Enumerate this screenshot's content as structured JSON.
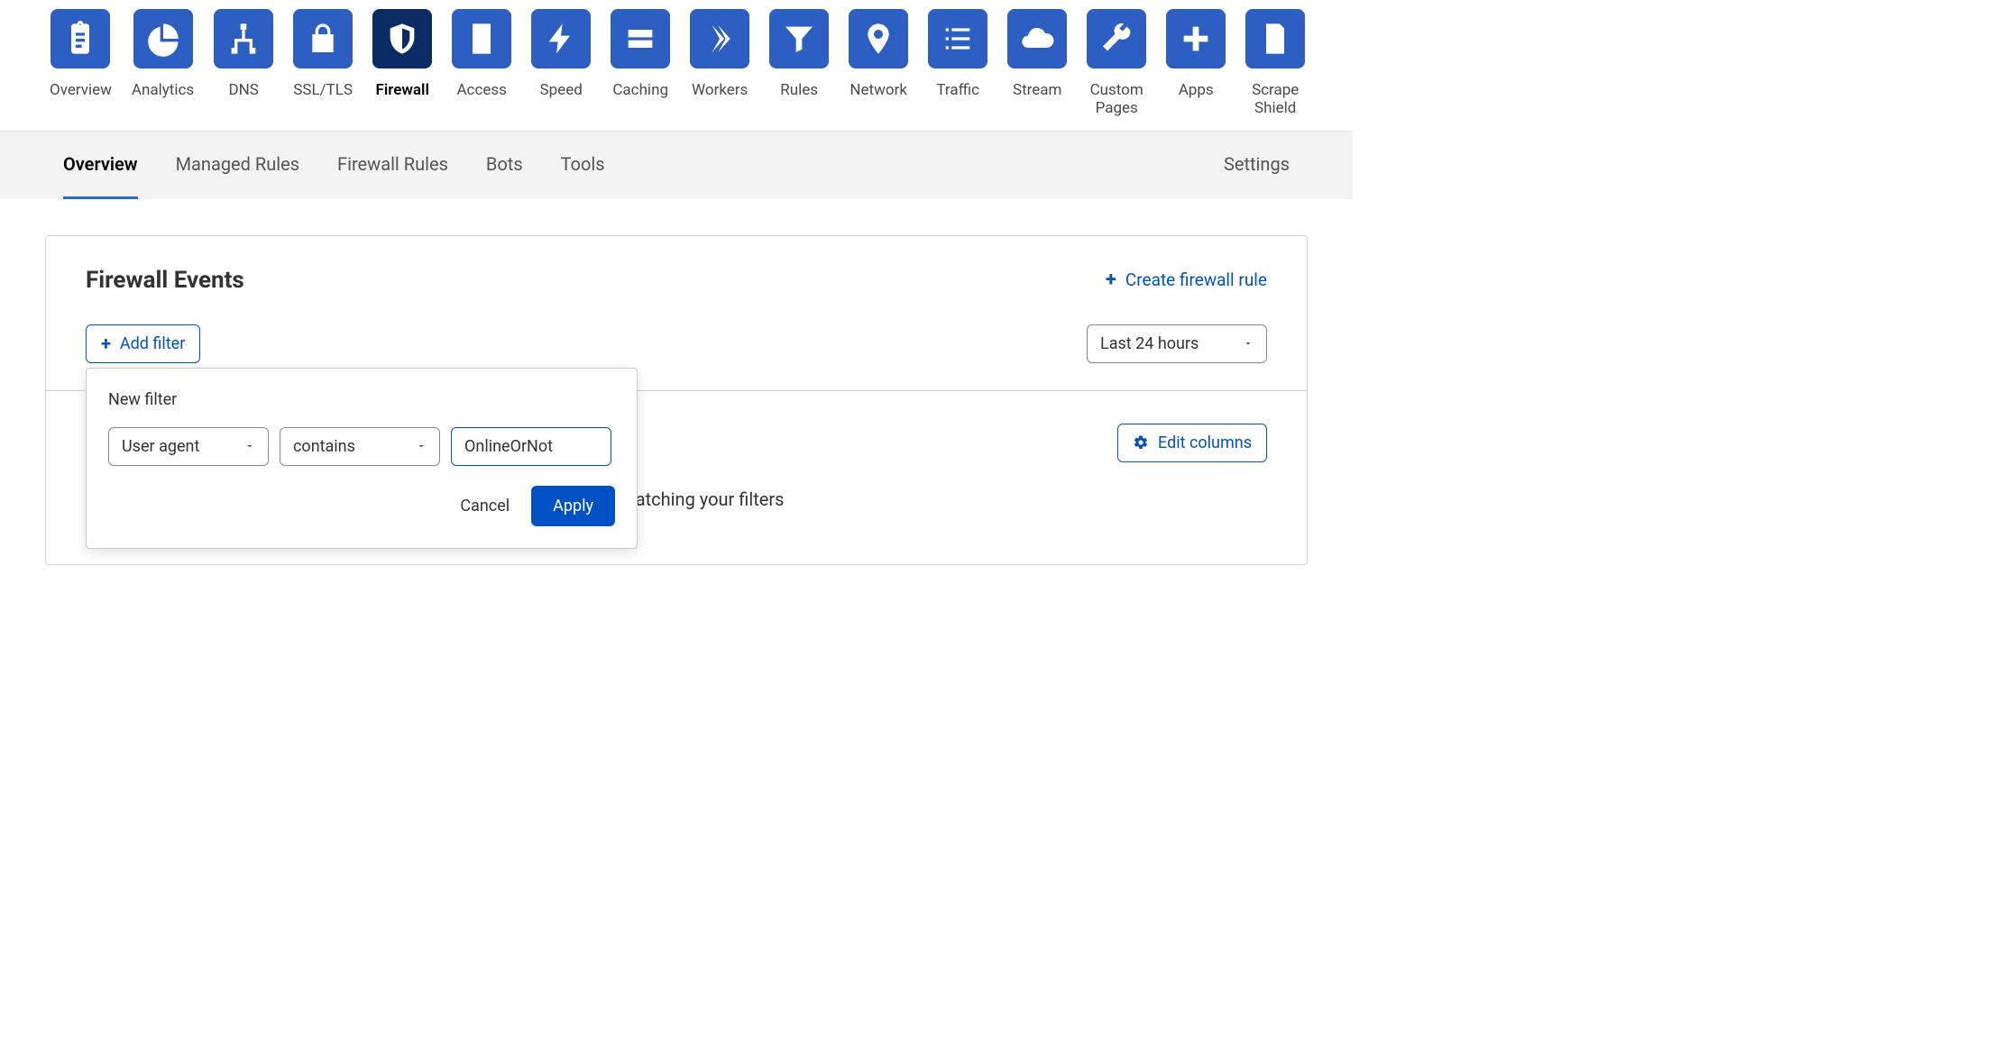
{
  "topNav": [
    {
      "label": "Overview",
      "icon": "clipboard"
    },
    {
      "label": "Analytics",
      "icon": "pie"
    },
    {
      "label": "DNS",
      "icon": "sitemap"
    },
    {
      "label": "SSL/TLS",
      "icon": "lock"
    },
    {
      "label": "Firewall",
      "icon": "shield",
      "active": true
    },
    {
      "label": "Access",
      "icon": "door"
    },
    {
      "label": "Speed",
      "icon": "bolt"
    },
    {
      "label": "Caching",
      "icon": "drive"
    },
    {
      "label": "Workers",
      "icon": "workers"
    },
    {
      "label": "Rules",
      "icon": "funnel"
    },
    {
      "label": "Network",
      "icon": "pin"
    },
    {
      "label": "Traffic",
      "icon": "list"
    },
    {
      "label": "Stream",
      "icon": "cloud"
    },
    {
      "label": "Custom Pages",
      "icon": "wrench"
    },
    {
      "label": "Apps",
      "icon": "plus"
    },
    {
      "label": "Scrape Shield",
      "icon": "doc"
    }
  ],
  "subTabs": {
    "items": [
      "Overview",
      "Managed Rules",
      "Firewall Rules",
      "Bots",
      "Tools"
    ],
    "activeIndex": 0,
    "settings": "Settings"
  },
  "card": {
    "title": "Firewall Events",
    "createRule": "Create firewall rule",
    "addFilter": "Add filter",
    "timeRange": "Last 24 hours",
    "editColumns": "Edit columns",
    "emptyMessage": "found matching your filters"
  },
  "popover": {
    "title": "New filter",
    "field": "User agent",
    "operator": "contains",
    "value": "OnlineOrNot",
    "cancel": "Cancel",
    "apply": "Apply"
  }
}
